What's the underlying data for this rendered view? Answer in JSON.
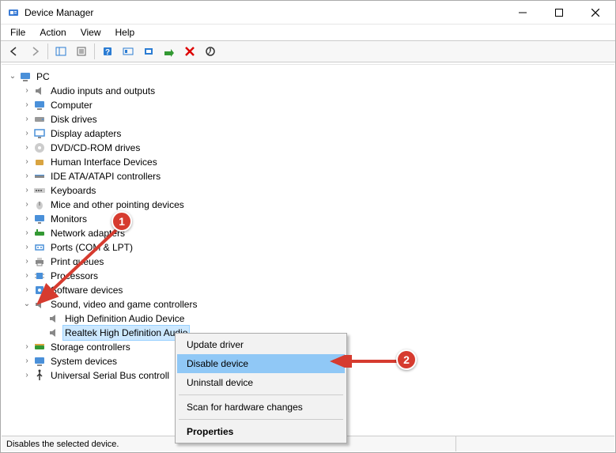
{
  "window": {
    "title": "Device Manager"
  },
  "menus": {
    "file": "File",
    "action": "Action",
    "view": "View",
    "help": "Help"
  },
  "tree": {
    "root": "PC",
    "items": [
      "Audio inputs and outputs",
      "Computer",
      "Disk drives",
      "Display adapters",
      "DVD/CD-ROM drives",
      "Human Interface Devices",
      "IDE ATA/ATAPI controllers",
      "Keyboards",
      "Mice and other pointing devices",
      "Monitors",
      "Network adapters",
      "Ports (COM & LPT)",
      "Print queues",
      "Processors",
      "Software devices",
      "Sound, video and game controllers",
      "Storage controllers",
      "System devices",
      "Universal Serial Bus controll"
    ],
    "sound_children": [
      "High Definition Audio Device",
      "Realtek High Definition Audio"
    ]
  },
  "context_menu": {
    "update": "Update driver",
    "disable": "Disable device",
    "uninstall": "Uninstall device",
    "scan": "Scan for hardware changes",
    "properties": "Properties"
  },
  "status": {
    "text": "Disables the selected device."
  },
  "annotations": {
    "one": "1",
    "two": "2"
  }
}
